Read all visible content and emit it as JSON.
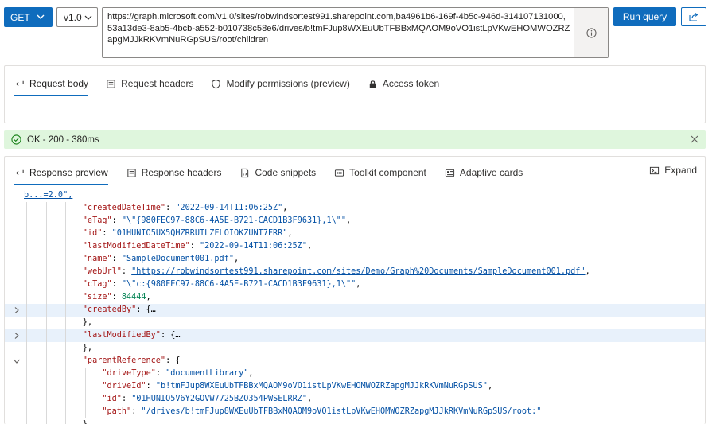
{
  "toolbar": {
    "method": "GET",
    "version": "v1.0",
    "url": "https://graph.microsoft.com/v1.0/sites/robwindsortest991.sharepoint.com,ba4961b6-169f-4b5c-946d-314107131000,53a13de3-8ab5-4bcb-a552-b010738c58e6/drives/b!tmFJup8WXEuUbTFBBxMQAOM9oVO1istLpVKwEHOMWOZRZapgMJJkRKVmNuRGpSUS/root/children",
    "run_label": "Run query"
  },
  "request_tabs": [
    {
      "label": "Request body",
      "icon": "arrow-return-icon",
      "active": true
    },
    {
      "label": "Request headers",
      "icon": "document-icon",
      "active": false
    },
    {
      "label": "Modify permissions (preview)",
      "icon": "shield-icon",
      "active": false
    },
    {
      "label": "Access token",
      "icon": "lock-icon",
      "active": false
    }
  ],
  "status": {
    "text": "OK - 200 - 380ms",
    "color": "#dff6dd"
  },
  "response_tabs": [
    {
      "label": "Response preview",
      "icon": "arrow-return-icon",
      "active": true
    },
    {
      "label": "Response headers",
      "icon": "document-icon",
      "active": false
    },
    {
      "label": "Code snippets",
      "icon": "code-icon",
      "active": false
    },
    {
      "label": "Toolkit component",
      "icon": "toolkit-icon",
      "active": false
    },
    {
      "label": "Adaptive cards",
      "icon": "card-icon",
      "active": false
    }
  ],
  "expand_label": "Expand",
  "code_lines": [
    {
      "text": "b...=2.0\",",
      "kind": "cut"
    },
    {
      "key": "\"createdDateTime\"",
      "value": "\"2022-09-14T11:06:25Z\"",
      "vtype": "s",
      "tail": ","
    },
    {
      "key": "\"eTag\"",
      "value": "\"\\\"{980FEC97-88C6-4A5E-B721-CACD1B3F9631},1\\\"\"",
      "vtype": "s",
      "tail": ","
    },
    {
      "key": "\"id\"",
      "value": "\"01HUNIO5UX5QHZRRUILZFLOIOKZUNT7FRR\"",
      "vtype": "s",
      "tail": ","
    },
    {
      "key": "\"lastModifiedDateTime\"",
      "value": "\"2022-09-14T11:06:25Z\"",
      "vtype": "s",
      "tail": ","
    },
    {
      "key": "\"name\"",
      "value": "\"SampleDocument001.pdf\"",
      "vtype": "s",
      "tail": ","
    },
    {
      "key": "\"webUrl\"",
      "value": "\"https://robwindsortest991.sharepoint.com/sites/Demo/Graph%20Documents/SampleDocument001.pdf\"",
      "vtype": "u",
      "tail": ","
    },
    {
      "key": "\"cTag\"",
      "value": "\"\\\"c:{980FEC97-88C6-4A5E-B721-CACD1B3F9631},1\\\"\"",
      "vtype": "s",
      "tail": ","
    },
    {
      "key": "\"size\"",
      "value": "84444",
      "vtype": "n",
      "tail": ","
    },
    {
      "key": "\"createdBy\"",
      "value": "{…",
      "vtype": "p",
      "tail": ""
    },
    {
      "text": "},"
    },
    {
      "key": "\"lastModifiedBy\"",
      "value": "{…",
      "vtype": "p",
      "tail": ""
    },
    {
      "text": "},"
    },
    {
      "key": "\"parentReference\"",
      "value": "{",
      "vtype": "p",
      "tail": ""
    },
    {
      "key": "\"driveType\"",
      "value": "\"documentLibrary\"",
      "vtype": "s",
      "tail": ","
    },
    {
      "key": "\"driveId\"",
      "value": "\"b!tmFJup8WXEuUbTFBBxMQAOM9oVO1istLpVKwEHOMWOZRZapgMJJkRKVmNuRGpSUS\"",
      "vtype": "s",
      "tail": ","
    },
    {
      "key": "\"id\"",
      "value": "\"01HUNIO5V6Y2GOVW7725BZO354PWSELRRZ\"",
      "vtype": "s",
      "tail": ","
    },
    {
      "key": "\"path\"",
      "value": "\"/drives/b!tmFJup8WXEuUbTFBBxMQAOM9oVO1istLpVKwEHOMWOZRZapgMJJkRKVmNuRGpSUS/root:\"",
      "vtype": "s",
      "tail": ""
    },
    {
      "text": "},"
    }
  ]
}
